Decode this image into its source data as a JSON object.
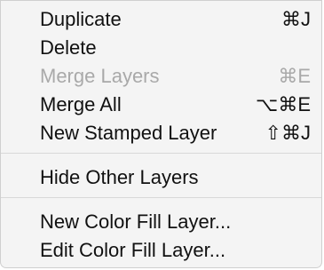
{
  "menu": {
    "items": [
      {
        "label": "Duplicate",
        "shortcut": "⌘J",
        "enabled": true
      },
      {
        "label": "Delete",
        "shortcut": "",
        "enabled": true
      },
      {
        "label": "Merge Layers",
        "shortcut": "⌘E",
        "enabled": false
      },
      {
        "label": "Merge All",
        "shortcut": "⌥⌘E",
        "enabled": true
      },
      {
        "label": "New Stamped Layer",
        "shortcut": "⇧⌘J",
        "enabled": true
      },
      {
        "label": "Hide Other Layers",
        "shortcut": "",
        "enabled": true
      },
      {
        "label": "New Color Fill Layer...",
        "shortcut": "",
        "enabled": true
      },
      {
        "label": "Edit Color Fill Layer...",
        "shortcut": "",
        "enabled": true
      }
    ]
  }
}
